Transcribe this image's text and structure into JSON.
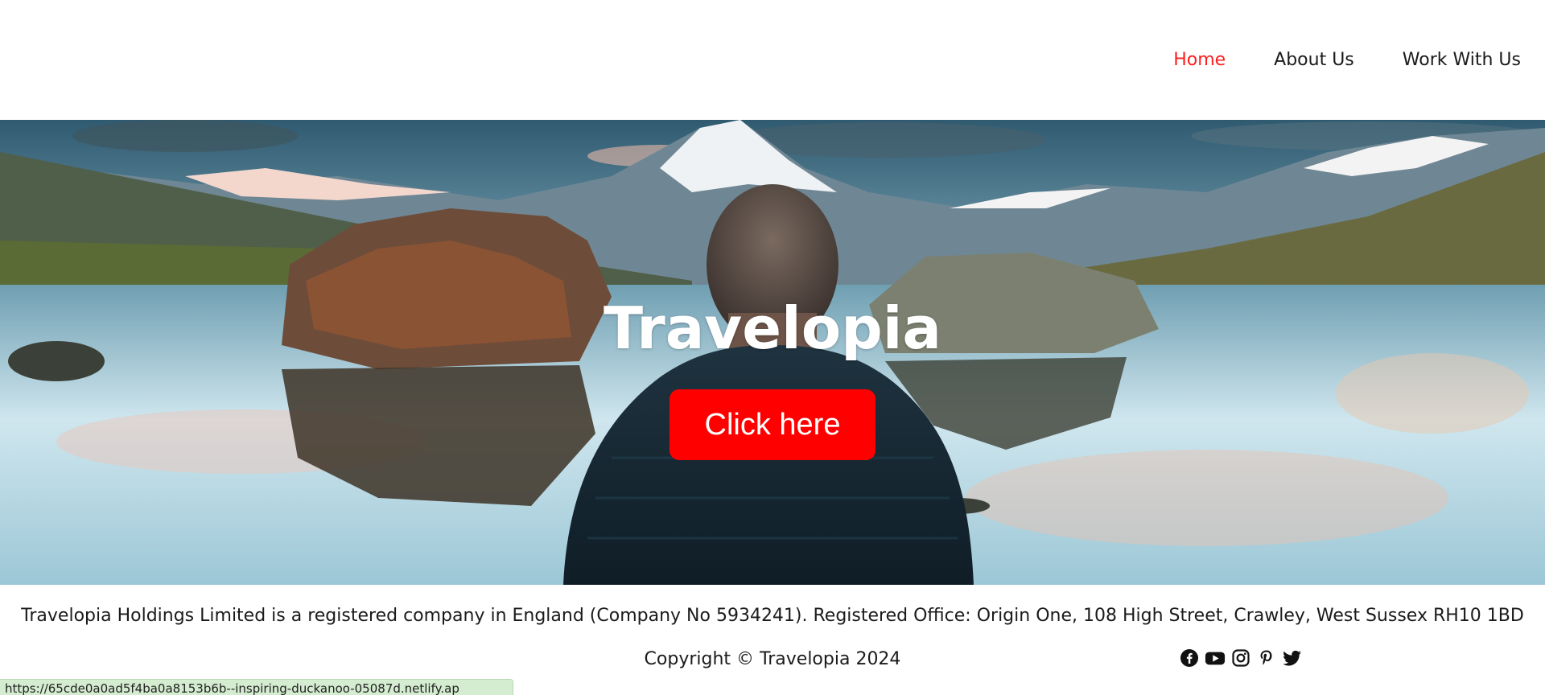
{
  "nav": {
    "items": [
      {
        "label": "Home",
        "active": true
      },
      {
        "label": "About Us",
        "active": false
      },
      {
        "label": "Work With Us",
        "active": false
      }
    ],
    "active_color": "#ff1e1e"
  },
  "hero": {
    "title": "Travelopia",
    "cta_label": "Click here",
    "cta_color": "#ff0000"
  },
  "footer": {
    "legal": "Travelopia Holdings Limited is a registered company in England (Company No 5934241). Registered Office: Origin One, 108 High Street, Crawley, West Sussex RH10 1BD",
    "copyright": "Copyright © Travelopia 2024",
    "social_icons": [
      "facebook-icon",
      "youtube-icon",
      "instagram-icon",
      "pinterest-icon",
      "twitter-icon"
    ]
  },
  "statusbar": {
    "url": "https://65cde0a0ad5f4ba0a8153b6b--inspiring-duckanoo-05087d.netlify.ap"
  }
}
